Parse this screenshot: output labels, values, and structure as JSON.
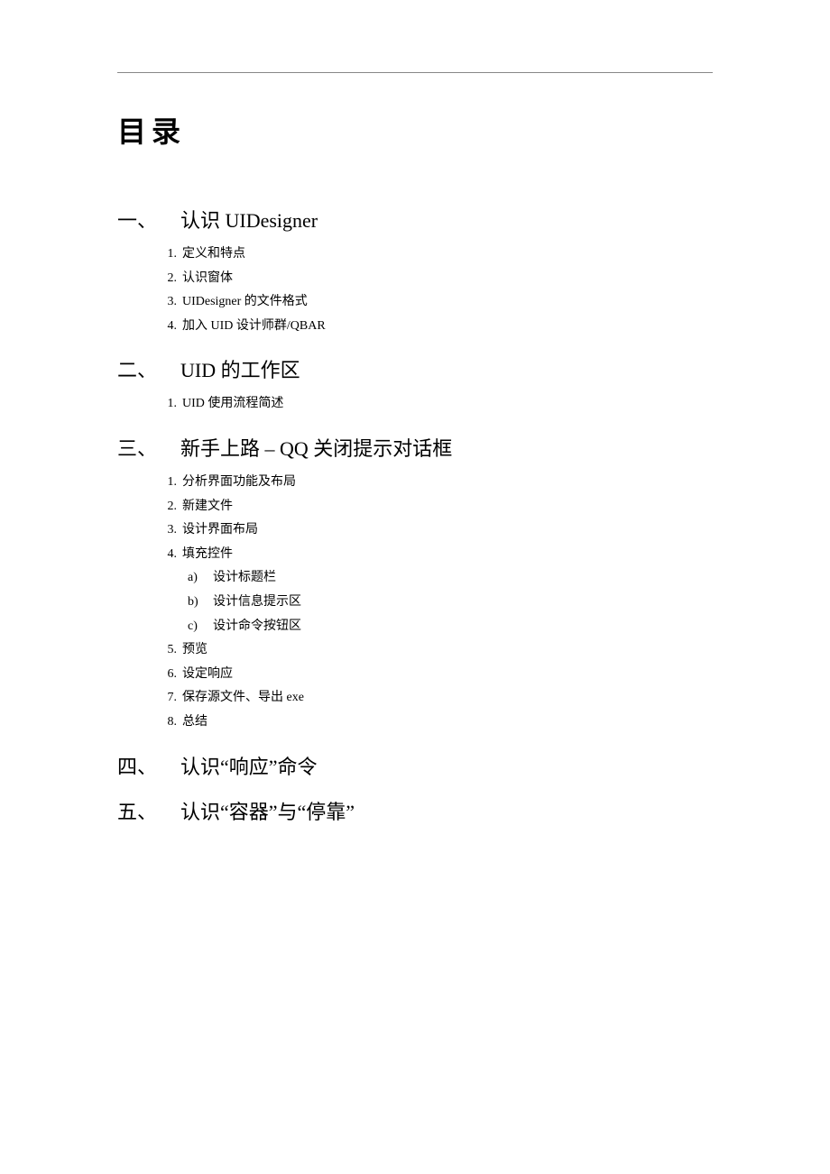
{
  "title": "目录",
  "sections": [
    {
      "num": "一、",
      "label": "认识 UIDesigner",
      "items": [
        {
          "num": "1.",
          "label": "定义和特点"
        },
        {
          "num": "2.",
          "label": "认识窗体"
        },
        {
          "num": "3.",
          "label": "UIDesigner 的文件格式"
        },
        {
          "num": "4.",
          "label": "加入 UID 设计师群/QBAR"
        }
      ]
    },
    {
      "num": "二、",
      "label": "UID 的工作区",
      "items": [
        {
          "num": "1.",
          "label": "UID 使用流程简述"
        }
      ]
    },
    {
      "num": "三、",
      "label": "新手上路  –  QQ 关闭提示对话框",
      "items": [
        {
          "num": "1.",
          "label": "分析界面功能及布局"
        },
        {
          "num": "2.",
          "label": "新建文件"
        },
        {
          "num": "3.",
          "label": "设计界面布局"
        },
        {
          "num": "4.",
          "label": "填充控件",
          "subitems": [
            {
              "num": "a)",
              "label": "设计标题栏"
            },
            {
              "num": "b)",
              "label": "设计信息提示区"
            },
            {
              "num": "c)",
              "label": "设计命令按钮区"
            }
          ]
        },
        {
          "num": "5.",
          "label": "预览"
        },
        {
          "num": "6.",
          "label": "设定响应"
        },
        {
          "num": "7.",
          "label": "保存源文件、导出 exe"
        },
        {
          "num": "8.",
          "label": "总结"
        }
      ]
    },
    {
      "num": "四、",
      "label": "认识“响应”命令",
      "items": []
    },
    {
      "num": "五、",
      "label": "认识“容器”与“停靠”",
      "items": []
    }
  ]
}
